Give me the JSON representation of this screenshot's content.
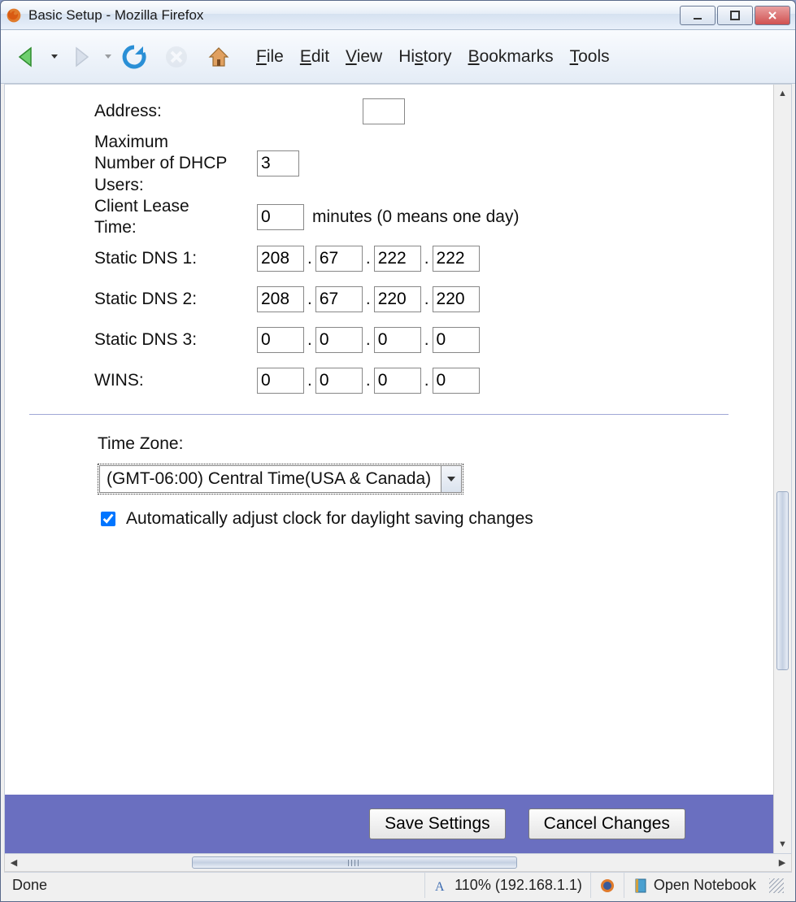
{
  "window": {
    "title": "Basic Setup - Mozilla Firefox"
  },
  "menu": {
    "file": "File",
    "edit": "Edit",
    "view": "View",
    "history": "History",
    "bookmarks": "Bookmarks",
    "tools": "Tools"
  },
  "form": {
    "address_label": "Address:",
    "max_dhcp_label_1": "Maximum",
    "max_dhcp_label_2": "Number of DHCP",
    "max_dhcp_label_3": "Users:",
    "max_dhcp_value": "3",
    "lease_label_1": "Client Lease",
    "lease_label_2": "Time:",
    "lease_value": "0",
    "lease_units": "minutes (0 means one day)",
    "dns1_label": "Static DNS 1:",
    "dns1": [
      "208",
      "67",
      "222",
      "222"
    ],
    "dns2_label": "Static DNS 2:",
    "dns2": [
      "208",
      "67",
      "220",
      "220"
    ],
    "dns3_label": "Static DNS 3:",
    "dns3": [
      "0",
      "0",
      "0",
      "0"
    ],
    "wins_label": "WINS:",
    "wins": [
      "0",
      "0",
      "0",
      "0"
    ],
    "tz_label": "Time Zone:",
    "tz_value": "(GMT-06:00) Central Time(USA & Canada)",
    "dst_label": "Automatically adjust clock for daylight saving changes",
    "save_label": "Save Settings",
    "cancel_label": "Cancel Changes"
  },
  "status": {
    "left": "Done",
    "zoom": "110% (192.168.1.1)",
    "notebook": "Open Notebook"
  },
  "colors": {
    "footer": "#6a6fc0"
  }
}
